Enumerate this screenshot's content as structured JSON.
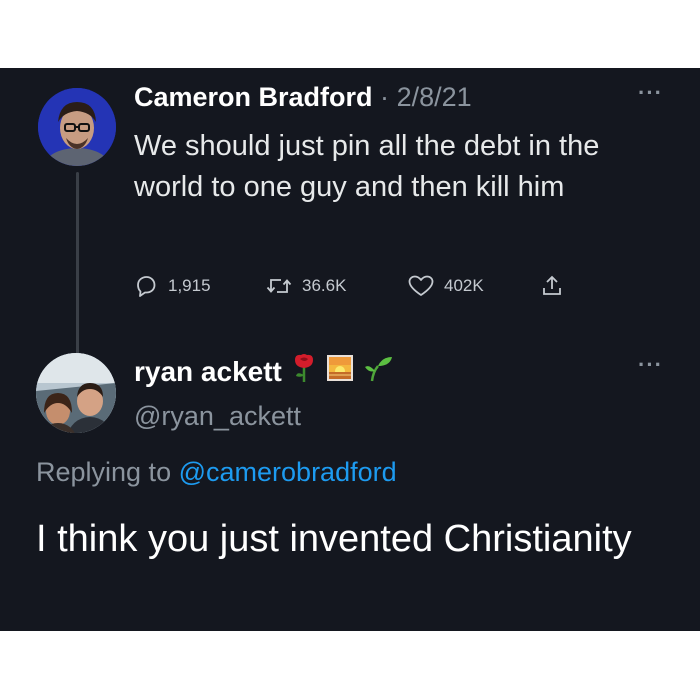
{
  "tweet": {
    "author_name": "Cameron Bradford",
    "separator": "·",
    "date": "2/8/21",
    "more_label": "···",
    "text": "We should just pin all the debt in the world to one guy and then kill him",
    "stats": {
      "replies": "1,915",
      "retweets": "36.6K",
      "likes": "402K"
    }
  },
  "reply": {
    "author_name": "ryan ackett",
    "handle": "@ryan_ackett",
    "more_label": "···",
    "name_emojis": [
      "rose-emoji",
      "sunrise-emoji",
      "seedling-emoji"
    ],
    "replying_prefix": "Replying to",
    "replying_to": "@camerobradford",
    "text": "I think you just invented Christianity"
  },
  "colors": {
    "background": "#14171f",
    "text": "#e7e9ea",
    "muted": "#8b949e",
    "link": "#1d9bf0"
  }
}
